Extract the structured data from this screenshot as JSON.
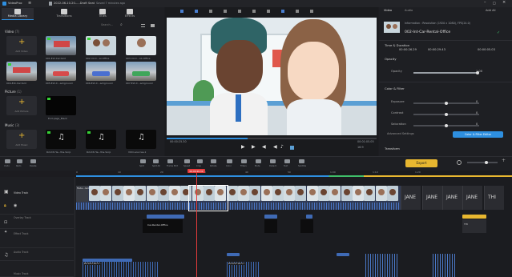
{
  "titlebar": {
    "app_name": "VideoProc",
    "file_name": "2022-06-10-20-...-Draft Seat",
    "save_status": "Saved 7 minutes ago"
  },
  "left_tabs": [
    {
      "label": "Media Library"
    },
    {
      "label": "Transitions"
    },
    {
      "label": "Titles"
    },
    {
      "label": "Effects"
    }
  ],
  "search": {
    "placeholder": "Search..."
  },
  "video_section": {
    "label": "Video",
    "count": "(7)",
    "add_label": "Add Video",
    "items": [
      "001-Ext-Car-Yard",
      "002-Int-C...al-Office",
      "003-Int-C...ob-Office",
      "004-Ext-Car-Yard",
      "005-Ext-C...ackground",
      "006-Ext-C...ackground",
      "007-Ext-C...ackground"
    ]
  },
  "picture_section": {
    "label": "Picture",
    "count": "(1)",
    "add_label": "Add Picture",
    "items": [
      "End-page_Black"
    ]
  },
  "music_section": {
    "label": "Music",
    "count": "(3)",
    "add_label": "Add Music",
    "items": [
      "R2-D3-He...the-Sorp",
      "R2-D3-He...the-Sorp",
      "VOO-sources-1"
    ]
  },
  "preview": {
    "time_current": "00:00:25.30",
    "time_total": "00:01:05.05",
    "ratio": "16:9"
  },
  "right_panel": {
    "tabs": [
      "Video",
      "Audio"
    ],
    "add_label": "Add All",
    "info_label": "Information : Resolution (1920 x 1080), FPS(24.0)",
    "clip_name": "002-Int-Car-Rental-Office",
    "time_duration": "Time & Duration",
    "start": "00:00:26.29",
    "end": "00:00:29.43",
    "duration": "00:00:05.03",
    "opacity_section": "Opacity",
    "opacity_label": "Opacity",
    "opacity_value": "1.00",
    "opacity_level": 1.0,
    "color_section": "Color & Filter",
    "exposure_label": "Exposure",
    "exposure_value": "0",
    "contrast_label": "Contrast",
    "contrast_value": "0",
    "saturation_label": "Saturation",
    "saturation_value": "0",
    "advanced_label": "Advanced Settings",
    "color_filter_button": "Color & Filter Editor",
    "transform_section": "Transform"
  },
  "toolbar": {
    "items": [
      "Undo",
      "Redo",
      "Delete",
      "Split",
      "Split All",
      "Frame Edit",
      "Speed",
      "Crop",
      "Rotate",
      "Color",
      "Filters",
      "Mute",
      "Detach",
      "Text",
      "Subtitle"
    ],
    "export_label": "Export",
    "ruler_label": "00:00:26.30",
    "zoom_label": "Zoom"
  },
  "tracks": [
    {
      "label": "Video Track",
      "clip_label": "Fade...lack"
    },
    {
      "label": "Overlay Track"
    },
    {
      "label": "Effect Track",
      "clip_label": "Car-Rental-Office"
    },
    {
      "label": "Audio Track"
    },
    {
      "label": "Music Track",
      "clip_label": "R2-D3-Herm..."
    }
  ],
  "title_clips": [
    "JANE",
    "JANE",
    "JANE",
    "JANE",
    "THI"
  ],
  "ruler_ticks": [
    "0",
    "10",
    "20",
    "30",
    "40",
    "50",
    "1:00",
    "1:10",
    "1:20"
  ],
  "colors": {
    "accent": "#2e8fe0",
    "gold": "#e8b730",
    "playhead": "#e53b3b",
    "green": "#35d135"
  }
}
